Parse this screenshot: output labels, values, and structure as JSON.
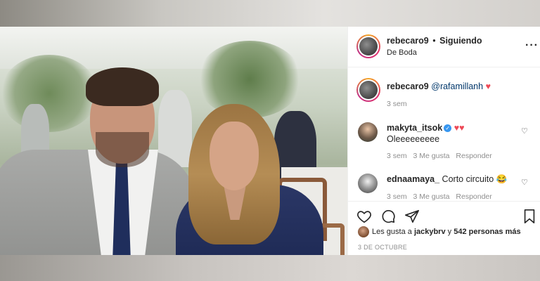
{
  "post": {
    "username": "rebecaro9",
    "separator": "•",
    "follow_status": "Siguiendo",
    "location": "De Boda",
    "more_icon": "more-horizontal-icon"
  },
  "caption": {
    "username": "rebecaro9",
    "mention": "@rafamillanh",
    "emoji": "♥",
    "time": "3 sem"
  },
  "comments": [
    {
      "username": "makyta_itsok",
      "verified": true,
      "emoji": "♥♥",
      "text": "Oleeeeeeeee",
      "time": "3 sem",
      "likes": "3 Me gusta",
      "reply": "Responder"
    },
    {
      "username": "ednaamaya_",
      "text": "Corto circuito",
      "emoji": "😂",
      "time": "3 sem",
      "likes": "3 Me gusta",
      "reply": "Responder"
    }
  ],
  "actions": {
    "like_icon": "heart-outline-icon",
    "comment_icon": "comment-icon",
    "share_icon": "send-icon",
    "save_icon": "bookmark-icon"
  },
  "likes": {
    "prefix": "Les gusta a",
    "user": "jackybrv",
    "connector": "y",
    "others": "542 personas más"
  },
  "date": "3 DE OCTUBRE",
  "colors": {
    "accent_heart": "#ed4956",
    "verified": "#3897f0",
    "muted_text": "#8e8e8e"
  }
}
